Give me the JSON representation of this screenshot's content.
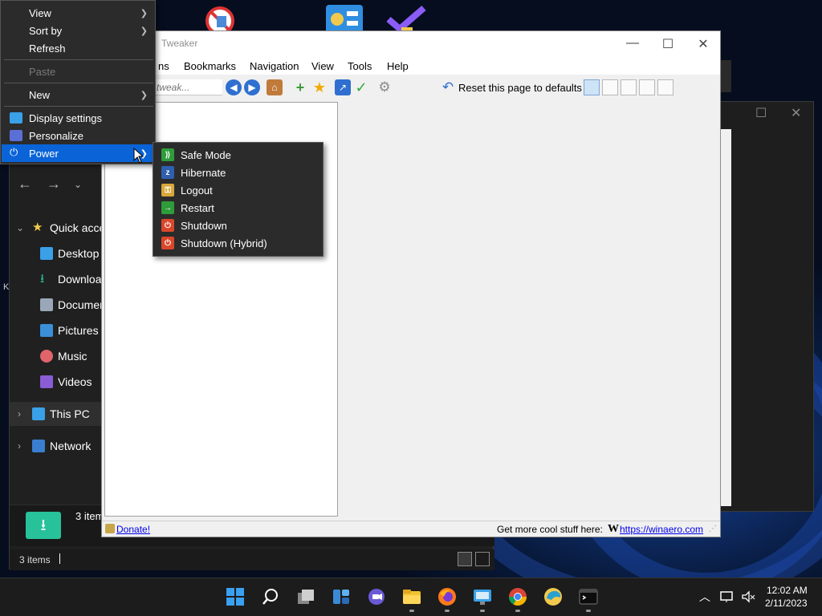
{
  "context_menu": {
    "items": [
      {
        "label": "View",
        "has_submenu": true,
        "disabled": false
      },
      {
        "label": "Sort by",
        "has_submenu": true,
        "disabled": false
      },
      {
        "label": "Refresh",
        "has_submenu": false,
        "disabled": false
      },
      {
        "label": "Paste",
        "has_submenu": false,
        "disabled": true
      },
      {
        "label": "New",
        "has_submenu": true,
        "disabled": false
      },
      {
        "label": "Display settings",
        "icon": "display-icon",
        "disabled": false
      },
      {
        "label": "Personalize",
        "icon": "personalize-icon",
        "disabled": false
      },
      {
        "label": "Power",
        "icon": "power-icon",
        "has_submenu": true,
        "highlighted": true
      }
    ]
  },
  "power_submenu": {
    "items": [
      {
        "label": "Safe Mode",
        "icon": "safe-mode-icon",
        "color": "#2e9c3a"
      },
      {
        "label": "Hibernate",
        "icon": "hibernate-icon",
        "color": "#2f5fae"
      },
      {
        "label": "Logout",
        "icon": "key-icon",
        "color": "#d8a83a"
      },
      {
        "label": "Restart",
        "icon": "restart-arrow-icon",
        "color": "#2e9c3a"
      },
      {
        "label": "Shutdown",
        "icon": "power-off-icon",
        "color": "#d9472b"
      },
      {
        "label": "Shutdown (Hybrid)",
        "icon": "power-off-icon",
        "color": "#d9472b"
      }
    ]
  },
  "tweaker": {
    "title": "Tweaker",
    "menu": [
      "ns",
      "Bookmarks",
      "Navigation",
      "View",
      "Tools",
      "Help"
    ],
    "search_placeholder": "tweak...",
    "reset_label": "Reset this page to defaults",
    "status": {
      "donate": "Donate!",
      "more": "Get more cool stuff here:",
      "w_badge": "W",
      "link": "https://winaero.com"
    }
  },
  "explorer": {
    "sidebar": [
      {
        "label": "Quick acce",
        "icon": "star-icon",
        "level": 0,
        "expanded": true
      },
      {
        "label": "Desktop",
        "icon": "desktop-folder-icon",
        "level": 1
      },
      {
        "label": "Download",
        "icon": "download-icon",
        "level": 1
      },
      {
        "label": "Documen",
        "icon": "documents-icon",
        "level": 1
      },
      {
        "label": "Pictures",
        "icon": "pictures-icon",
        "level": 1
      },
      {
        "label": "Music",
        "icon": "music-icon",
        "level": 1
      },
      {
        "label": "Videos",
        "icon": "videos-icon",
        "level": 1
      },
      {
        "label": "This PC",
        "icon": "this-pc-icon",
        "level": 0,
        "expanded": false
      },
      {
        "label": "Network",
        "icon": "network-icon",
        "level": 0,
        "expanded": false
      }
    ],
    "footer_items_text": "3 item",
    "status_text": "3 items",
    "left_edge_letter": "K"
  },
  "taskbar": {
    "icons": [
      "start-icon",
      "search-icon",
      "task-view-icon",
      "widgets-icon",
      "chat-icon",
      "file-explorer-icon",
      "firefox-icon",
      "remote-desktop-icon",
      "chrome-icon",
      "edge-canary-icon",
      "terminal-icon"
    ],
    "time": "12:02 AM",
    "date": "2/11/2023"
  },
  "colors": {
    "highlight": "#0a64d8",
    "menu_bg": "#2b2b2b",
    "taskbar_bg": "#1c1c1c"
  }
}
